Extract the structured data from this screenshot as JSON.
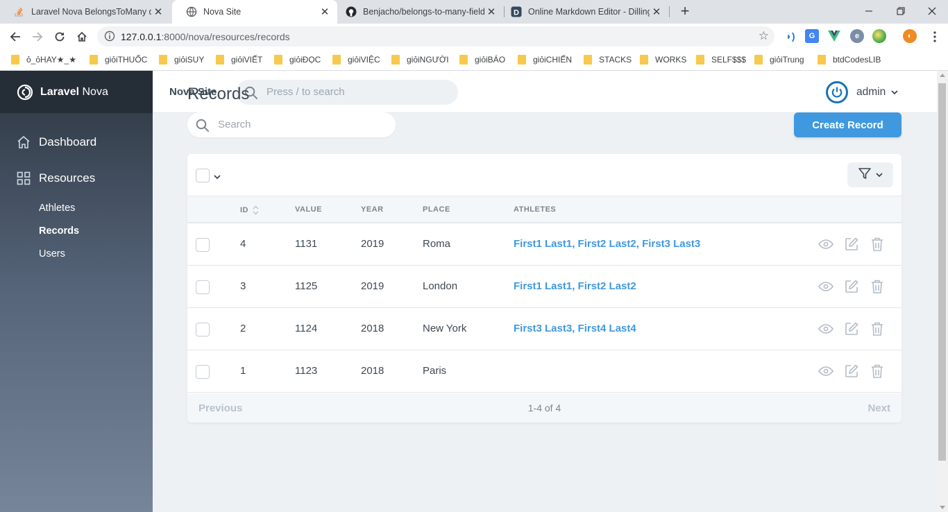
{
  "browser": {
    "tabs": [
      {
        "title": "Laravel Nova BelongsToMany dis",
        "icon": "stack-overflow-icon",
        "active": false
      },
      {
        "title": "Nova Site",
        "icon": "globe-icon",
        "active": true
      },
      {
        "title": "Benjacho/belongs-to-many-field",
        "icon": "github-icon",
        "active": false
      },
      {
        "title": "Online Markdown Editor - Dilling",
        "icon": "dillinger-icon",
        "active": false
      }
    ],
    "url_host": "127.0.0.1",
    "url_rest": ":8000/nova/resources/records",
    "bookmarks": [
      "ỏ_ỏHAY★_★",
      "giỏiTHUỐC",
      "giỏiSUY",
      "giỏiVIẾT",
      "giỏiĐỌC",
      "giỏiVIỆC",
      "giỏiNGƯỜI",
      "giỏiBÁO",
      "giỏiCHIẾN",
      "STACKS",
      "WORKS",
      "SELF$$$",
      "giỏiTrung",
      "btdCodesLIB"
    ]
  },
  "nova": {
    "brand_bold": "Laravel",
    "brand_rest": " Nova",
    "site_name": "Nova Site",
    "global_search_placeholder": "Press / to search",
    "user": "admin",
    "nav": {
      "dashboard": "Dashboard",
      "resources": "Resources",
      "items": [
        "Athletes",
        "Records",
        "Users"
      ]
    },
    "page_title": "Records",
    "search_placeholder": "Search",
    "create_button": "Create Record",
    "table": {
      "columns": [
        "ID",
        "VALUE",
        "YEAR",
        "PLACE",
        "ATHLETES"
      ],
      "rows": [
        {
          "id": "4",
          "value": "1131",
          "year": "2019",
          "place": "Roma",
          "athletes": "First1 Last1, First2 Last2, First3 Last3"
        },
        {
          "id": "3",
          "value": "1125",
          "year": "2019",
          "place": "London",
          "athletes": "First1 Last1, First2 Last2"
        },
        {
          "id": "2",
          "value": "1124",
          "year": "2018",
          "place": "New York",
          "athletes": "First3 Last3, First4 Last4"
        },
        {
          "id": "1",
          "value": "1123",
          "year": "2018",
          "place": "Paris",
          "athletes": ""
        }
      ]
    },
    "pagination": {
      "previous": "Previous",
      "count": "1-4 of 4",
      "next": "Next"
    },
    "colors": {
      "primary": "#4099de",
      "sidebar_top": "#353f4c",
      "sidebar_bottom": "#76859a",
      "text": "#3d4852"
    }
  }
}
